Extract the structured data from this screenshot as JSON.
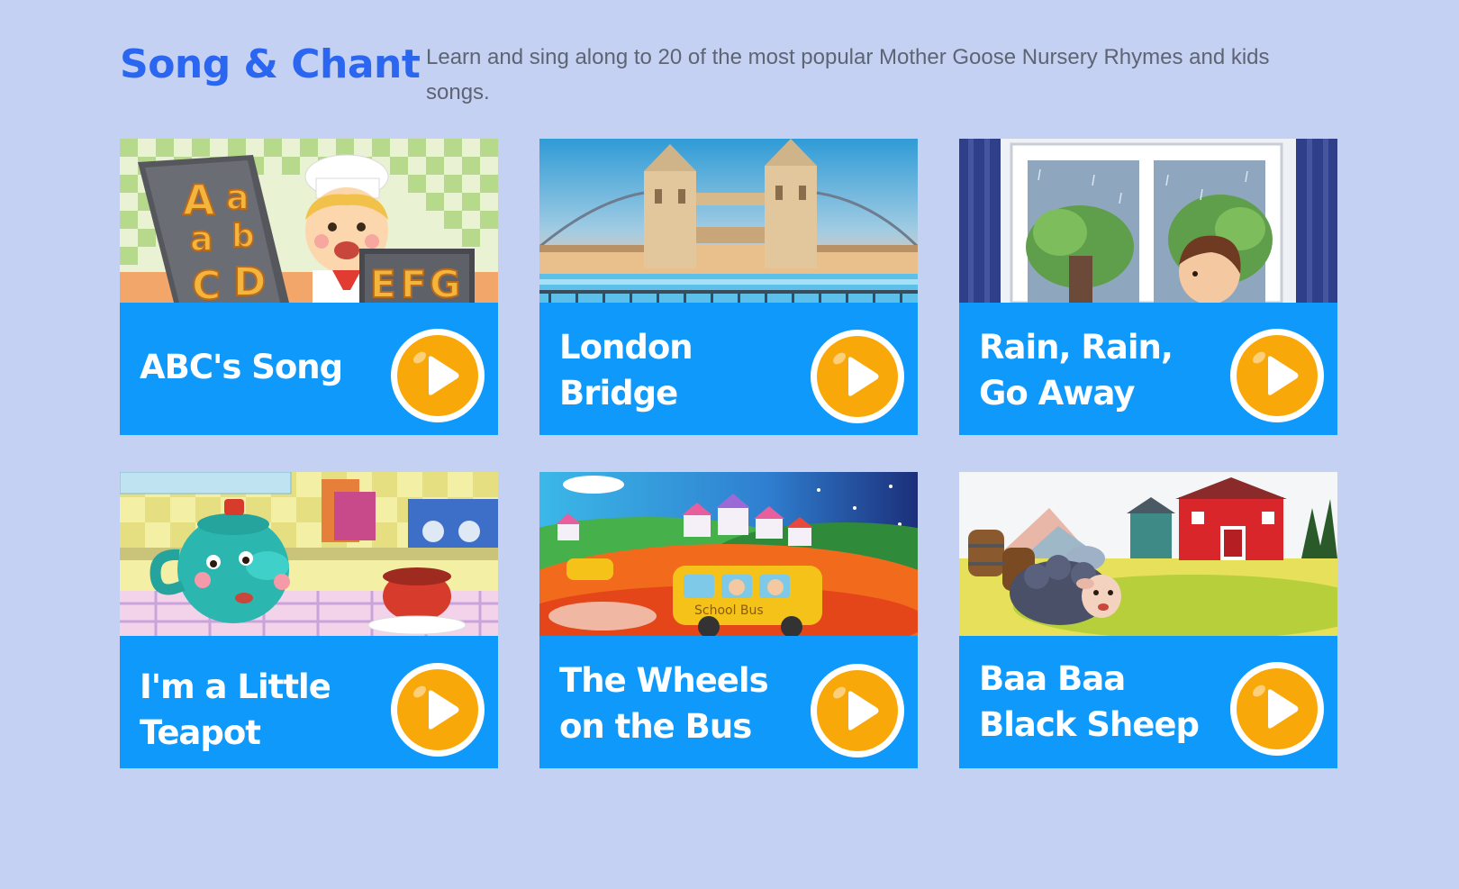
{
  "header": {
    "title": "Song & Chant",
    "description": "Learn and sing along to 20 of the most popular Mother Goose Nursery Rhymes and kids songs."
  },
  "colors": {
    "background": "#c5d1f3",
    "title": "#2b66f0",
    "card_panel": "#0f99fb",
    "play_button": "#f9a80a"
  },
  "songs": [
    {
      "line1": "ABC's Song",
      "line2": "",
      "art": "abc-chef-illustration",
      "play_icon": "play-icon"
    },
    {
      "line1": "London",
      "line2": "Bridge",
      "art": "tower-bridge-illustration",
      "play_icon": "play-icon"
    },
    {
      "line1": "Rain, Rain,",
      "line2": "Go Away",
      "art": "rainy-window-illustration",
      "play_icon": "play-icon"
    },
    {
      "line1": "I'm a Little",
      "line2": "Teapot",
      "art": "teapot-kitchen-illustration",
      "play_icon": "play-icon"
    },
    {
      "line1": "The Wheels",
      "line2": "on the Bus",
      "art": "school-bus-illustration",
      "play_icon": "play-icon"
    },
    {
      "line1": "Baa Baa",
      "line2": "Black Sheep",
      "art": "farm-sheep-illustration",
      "play_icon": "play-icon"
    }
  ]
}
